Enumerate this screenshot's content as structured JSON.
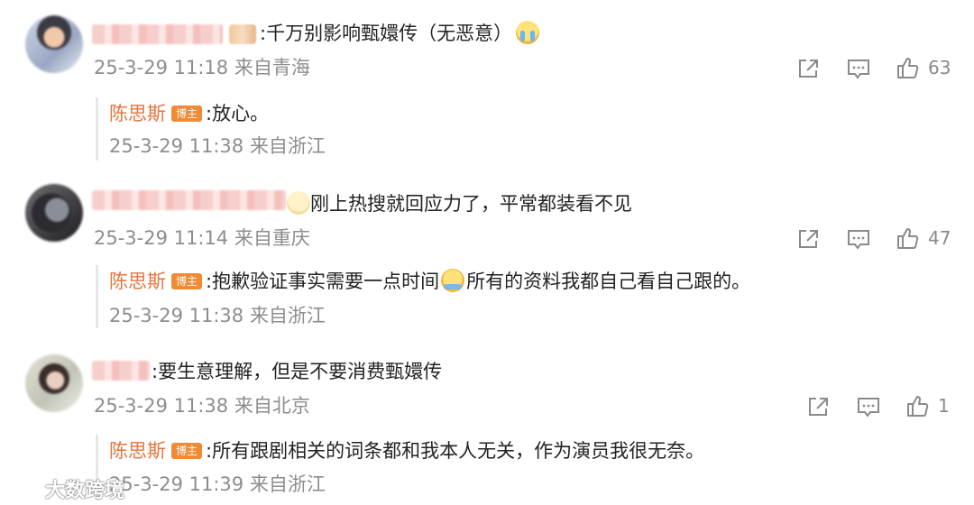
{
  "comments": [
    {
      "text": ":千万别影响甄嬛传（无恶意）",
      "meta": "25-3-29 11:18 来自青海",
      "likes": "63",
      "reply": {
        "name": "陈思斯",
        "badge": "博主",
        "text": ":放心。",
        "meta": "25-3-29 11:38 来自浙江"
      }
    },
    {
      "text": "刚上热搜就回应力了，平常都装看不见",
      "meta": "25-3-29 11:14 来自重庆",
      "likes": "47",
      "reply": {
        "name": "陈思斯",
        "badge": "博主",
        "text_a": ":抱歉验证事实需要一点时间",
        "text_b": "所有的资料我都自己看自己跟的。",
        "meta": "25-3-29 11:38 来自浙江"
      }
    },
    {
      "text": ":要生意理解，但是不要消费甄嬛传",
      "meta": "25-3-29 11:38 来自北京",
      "likes": "1",
      "reply": {
        "name": "陈思斯",
        "badge": "博主",
        "text": ":所有跟剧相关的词条都和我本人无关，作为演员我很无奈。",
        "meta": "25-3-29 11:39 来自浙江"
      }
    }
  ],
  "icons": {
    "share": "share-icon",
    "comment": "comment-icon",
    "like": "thumbs-up-icon"
  },
  "watermark": {
    "text": "大数跨境"
  },
  "colors": {
    "accent_name": "#e6753e",
    "badge_bg": "#f08a35",
    "meta": "#8d8d8d"
  }
}
